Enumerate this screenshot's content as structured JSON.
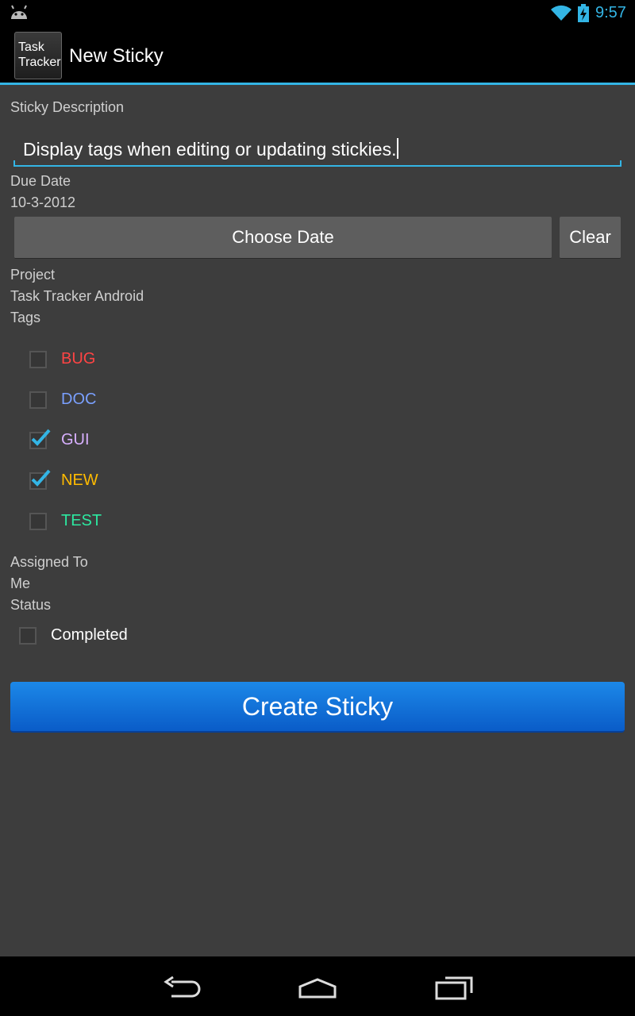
{
  "status_bar": {
    "time": "9:57",
    "icons": [
      "android-icon",
      "wifi-icon",
      "battery-charging-icon"
    ]
  },
  "action_bar": {
    "logo_line1": "Task",
    "logo_line2": "Tracker",
    "title": "New Sticky"
  },
  "form": {
    "description_label": "Sticky Description",
    "description_value": "Display tags when editing or updating stickies.",
    "due_date_label": "Due Date",
    "due_date_value": "10-3-2012",
    "choose_date_button": "Choose Date",
    "clear_button": "Clear",
    "project_label": "Project",
    "project_value": "Task Tracker Android",
    "tags_label": "Tags",
    "tags": [
      {
        "label": "BUG",
        "checked": false,
        "color": "#ff4444"
      },
      {
        "label": "DOC",
        "checked": false,
        "color": "#7aa0ff"
      },
      {
        "label": "GUI",
        "checked": true,
        "color": "#d8b0ff"
      },
      {
        "label": "NEW",
        "checked": true,
        "color": "#ffbb00"
      },
      {
        "label": "TEST",
        "checked": false,
        "color": "#2de8a0"
      }
    ],
    "assigned_label": "Assigned To",
    "assigned_value": "Me",
    "status_label": "Status",
    "completed_label": "Completed",
    "completed_checked": false,
    "create_button": "Create Sticky"
  },
  "nav_bar": {
    "icons": [
      "back-icon",
      "home-icon",
      "recent-apps-icon"
    ]
  },
  "colors": {
    "accent": "#33b5e5",
    "background": "#3d3d3d",
    "create_button": "#1576dc"
  }
}
